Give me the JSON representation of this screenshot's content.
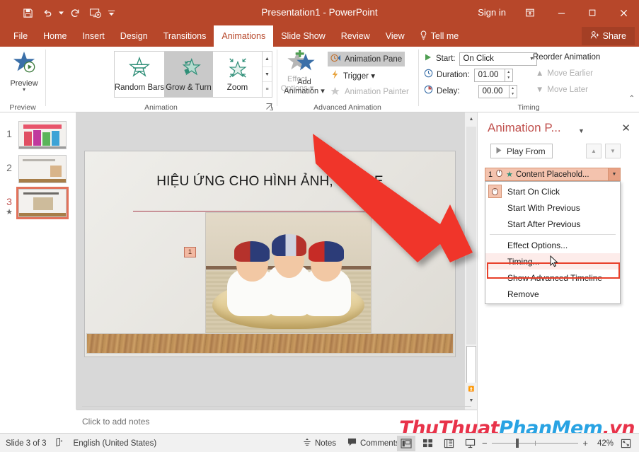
{
  "titlebar": {
    "document_title": "Presentation1  -  PowerPoint",
    "signin_label": "Sign in",
    "quick_access": [
      {
        "name": "save-icon",
        "label": "Save"
      },
      {
        "name": "undo-icon",
        "label": "Undo"
      },
      {
        "name": "redo-icon",
        "label": "Redo"
      },
      {
        "name": "start-from-beginning-icon",
        "label": "Start From Beginning"
      },
      {
        "name": "customize-quick-access-icon",
        "label": "Customize Quick Access Toolbar"
      }
    ],
    "window_controls": [
      {
        "name": "ribbon-display-options-icon",
        "glyph": "⤒"
      },
      {
        "name": "minimize-icon",
        "glyph": "─"
      },
      {
        "name": "maximize-icon",
        "glyph": "☐"
      },
      {
        "name": "close-icon",
        "glyph": "✕"
      }
    ]
  },
  "ribbon": {
    "tabs": [
      {
        "label": "File",
        "active": false
      },
      {
        "label": "Home",
        "active": false
      },
      {
        "label": "Insert",
        "active": false
      },
      {
        "label": "Design",
        "active": false
      },
      {
        "label": "Transitions",
        "active": false
      },
      {
        "label": "Animations",
        "active": true
      },
      {
        "label": "Slide Show",
        "active": false
      },
      {
        "label": "Review",
        "active": false
      },
      {
        "label": "View",
        "active": false
      }
    ],
    "tell_me": "Tell me",
    "share": "Share",
    "groups": {
      "preview": {
        "label": "Preview",
        "button_label": "Preview"
      },
      "animation": {
        "label": "Animation",
        "gallery": [
          {
            "label": "Random Bars",
            "selected": false
          },
          {
            "label": "Grow & Turn",
            "selected": true
          },
          {
            "label": "Zoom",
            "selected": false
          }
        ],
        "effect_options": "Effect\nOptions",
        "effect_options_line1": "Effect",
        "effect_options_line2": "Options",
        "disabled": true
      },
      "advanced_animation": {
        "label": "Advanced Animation",
        "add_animation_line1": "Add",
        "add_animation_line2": "Animation",
        "commands": [
          {
            "label": "Animation Pane",
            "state": "toggled-on",
            "icon": "animation-pane-icon"
          },
          {
            "label": "Trigger",
            "state": "enabled",
            "icon": "trigger-icon"
          },
          {
            "label": "Animation Painter",
            "state": "disabled",
            "icon": "animation-painter-icon"
          }
        ]
      },
      "timing": {
        "label": "Timing",
        "start_label": "Start:",
        "start_value": "On Click",
        "duration_label": "Duration:",
        "duration_value": "01.00",
        "delay_label": "Delay:",
        "delay_value": "00.00",
        "reorder_title": "Reorder Animation",
        "move_earlier": "Move Earlier",
        "move_later": "Move Later"
      }
    }
  },
  "thumbnails": [
    {
      "number": "1",
      "selected": false,
      "has_animation_star": false
    },
    {
      "number": "2",
      "selected": false,
      "has_animation_star": false
    },
    {
      "number": "3",
      "selected": true,
      "has_animation_star": true,
      "star": "★"
    }
  ],
  "slide": {
    "title": "HIỆU ỨNG CHO HÌNH ẢNH, SHAPE",
    "animation_badge": "1"
  },
  "notes": {
    "placeholder": "Click to add notes"
  },
  "animation_pane": {
    "title": "Animation P...",
    "play_from": "Play From",
    "move_up": "▲",
    "move_down": "▼",
    "item": {
      "index": "1",
      "name": "Content Placehold...",
      "star_icon": "★"
    },
    "menu": [
      {
        "label": "Start On Click",
        "accel": "C",
        "has_icon": true,
        "highlighted": false
      },
      {
        "label": "Start With Previous",
        "accel": "W",
        "has_icon": false,
        "highlighted": false
      },
      {
        "label": "Start After Previous",
        "accel": "A",
        "has_icon": false,
        "highlighted": false
      },
      {
        "separator": true
      },
      {
        "label": "Effect Options...",
        "accel": "E",
        "has_icon": false,
        "highlighted": false
      },
      {
        "label": "Timing...",
        "accel": "T",
        "has_icon": false,
        "highlighted": true
      },
      {
        "label": "Show Advanced Timeline",
        "accel": "S",
        "has_icon": false,
        "highlighted": false
      },
      {
        "label": "Remove",
        "accel": "R",
        "has_icon": false,
        "highlighted": false
      }
    ]
  },
  "statusbar": {
    "slide_indicator": "Slide 3 of 3",
    "language": "English (United States)",
    "notes_label": "Notes",
    "comments_label": "Comments",
    "zoom_percent": "42%",
    "views": [
      {
        "name": "normal-view-icon",
        "active": true
      },
      {
        "name": "slide-sorter-view-icon",
        "active": false
      },
      {
        "name": "reading-view-icon",
        "active": false
      },
      {
        "name": "slide-show-view-icon",
        "active": false
      }
    ],
    "zoom_out": "−",
    "zoom_in": "+",
    "fit_slide": "fit-to-window-icon"
  },
  "watermark": {
    "part1": "ThuThuat",
    "part2": "PhanMem",
    "part3": ".vn"
  },
  "colors": {
    "accent": "#b7472a",
    "pane_title": "#c0504d",
    "highlight_box": "#e8402a",
    "selection": "#f4c3ae"
  }
}
